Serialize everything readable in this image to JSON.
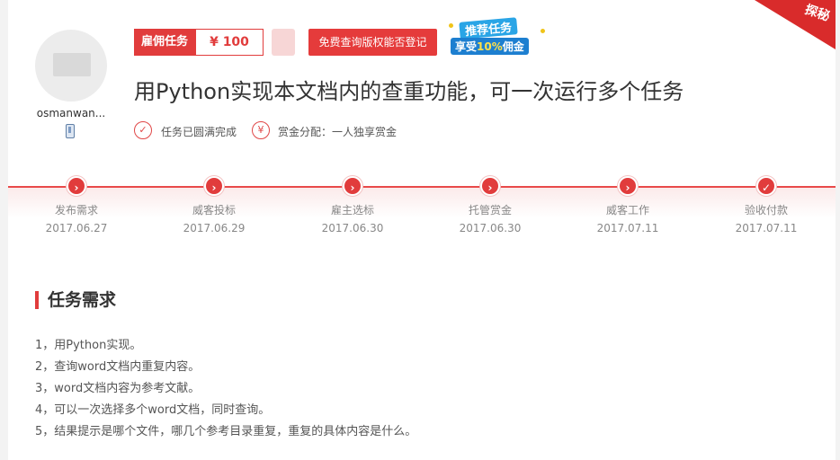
{
  "user": {
    "name": "osmanwan...",
    "device_icon": "mobile-phone-icon"
  },
  "task": {
    "type_label": "雇佣任务",
    "price": "¥ 100",
    "copyright_button": "免费查询版权能否登记",
    "promo_line1": "推荐任务",
    "promo_line2_prefix": "享受",
    "promo_line2_highlight": "10%",
    "promo_line2_suffix": "佣金",
    "corner_label": "探秘",
    "title": "用Python实现本文档内的查重功能，可一次运行多个任务",
    "status_text": "任务已圆满完成",
    "status_icon": "check-circle-icon",
    "reward_text": "赏金分配：一人独享赏金",
    "reward_icon": "yen-circle-icon"
  },
  "timeline": {
    "accent": "#e13c3c",
    "steps": [
      {
        "name": "发布需求",
        "date": "2017.06.27",
        "icon": "chevron-right-icon"
      },
      {
        "name": "威客投标",
        "date": "2017.06.29",
        "icon": "chevron-right-icon"
      },
      {
        "name": "雇主选标",
        "date": "2017.06.30",
        "icon": "chevron-right-icon"
      },
      {
        "name": "托管赏金",
        "date": "2017.06.30",
        "icon": "chevron-right-icon"
      },
      {
        "name": "威客工作",
        "date": "2017.07.11",
        "icon": "chevron-right-icon"
      },
      {
        "name": "验收付款",
        "date": "2017.07.11",
        "icon": "check-icon"
      }
    ]
  },
  "requirements": {
    "heading": "任务需求",
    "items": [
      "1，用Python实现。",
      "2，查询word文档内重复内容。",
      "3，word文档内容为参考文献。",
      "4，可以一次选择多个word文档，同时查询。",
      "5，结果提示是哪个文件，哪几个参考目录重复，重复的具体内容是什么。"
    ]
  }
}
